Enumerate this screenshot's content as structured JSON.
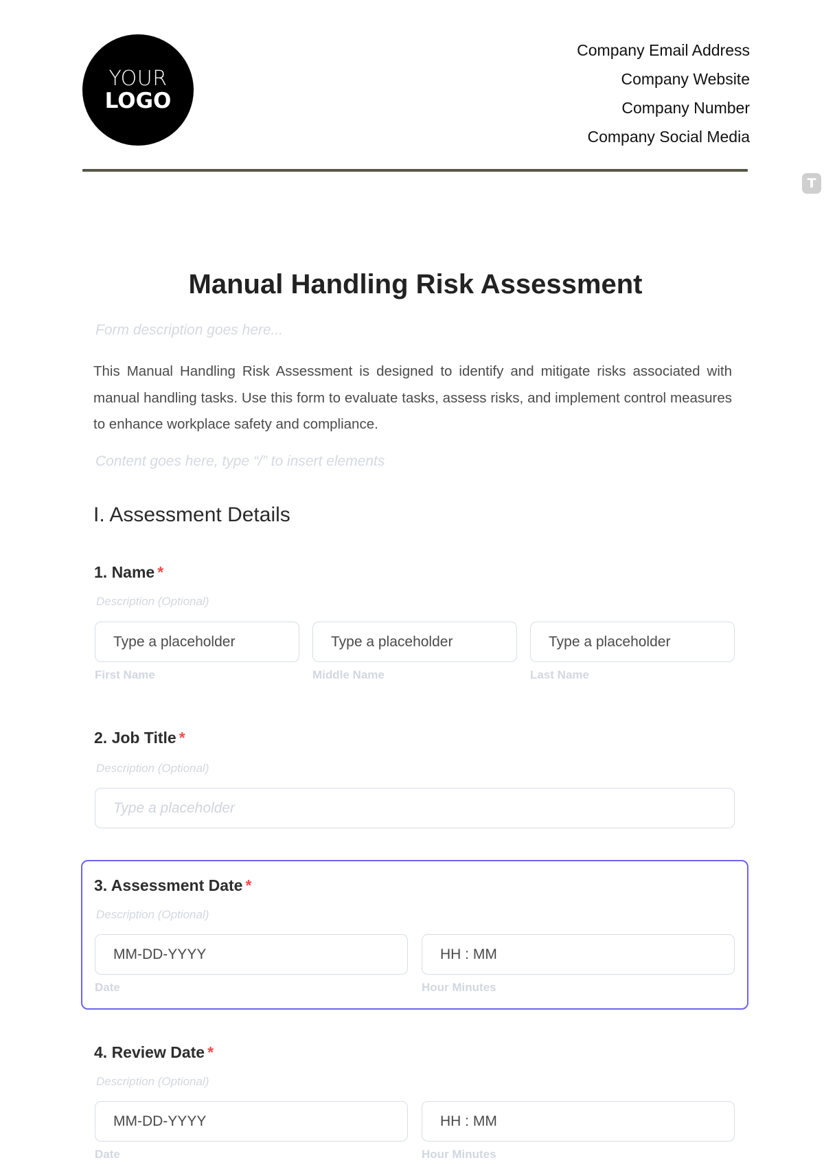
{
  "logo": {
    "line1": "YOUR",
    "line2": "LOGO"
  },
  "contact": {
    "email": "Company Email Address",
    "website": "Company Website",
    "number": "Company Number",
    "social": "Company Social Media"
  },
  "side_icon": {
    "glyph": "T",
    "name": "text-tool-icon"
  },
  "form": {
    "title": "Manual Handling Risk Assessment",
    "description_placeholder": "Form description goes here...",
    "intro": "This Manual Handling Risk Assessment is designed to identify and mitigate risks associated with manual handling tasks. Use this form to evaluate tasks, assess risks, and implement control measures to enhance workplace safety and compliance.",
    "content_placeholder": "Content goes here, type “/” to insert elements"
  },
  "section": {
    "heading": "I. Assessment Details"
  },
  "colors": {
    "required": "#ef4b4b",
    "focus_border": "#6c63f0",
    "divider": "#565646"
  },
  "fields": [
    {
      "label": "1. Name",
      "required": "*",
      "description": "Description (Optional)",
      "inputs": [
        {
          "value": "Type a placeholder",
          "sublabel": "First Name"
        },
        {
          "value": "Type a placeholder",
          "sublabel": "Middle Name"
        },
        {
          "value": "Type a placeholder",
          "sublabel": "Last Name"
        }
      ]
    },
    {
      "label": "2. Job Title",
      "required": "*",
      "description": "Description (Optional)",
      "inputs": [
        {
          "placeholder": "Type a placeholder"
        }
      ]
    },
    {
      "label": "3. Assessment Date",
      "required": "*",
      "description": "Description (Optional)",
      "focused": true,
      "inputs": [
        {
          "value": "MM-DD-YYYY",
          "sublabel": "Date"
        },
        {
          "value": "HH : MM",
          "sublabel": "Hour Minutes"
        }
      ]
    },
    {
      "label": "4. Review Date",
      "required": "*",
      "description": "Description (Optional)",
      "inputs": [
        {
          "value": "MM-DD-YYYY",
          "sublabel": "Date"
        },
        {
          "value": "HH : MM",
          "sublabel": "Hour Minutes"
        }
      ]
    }
  ]
}
